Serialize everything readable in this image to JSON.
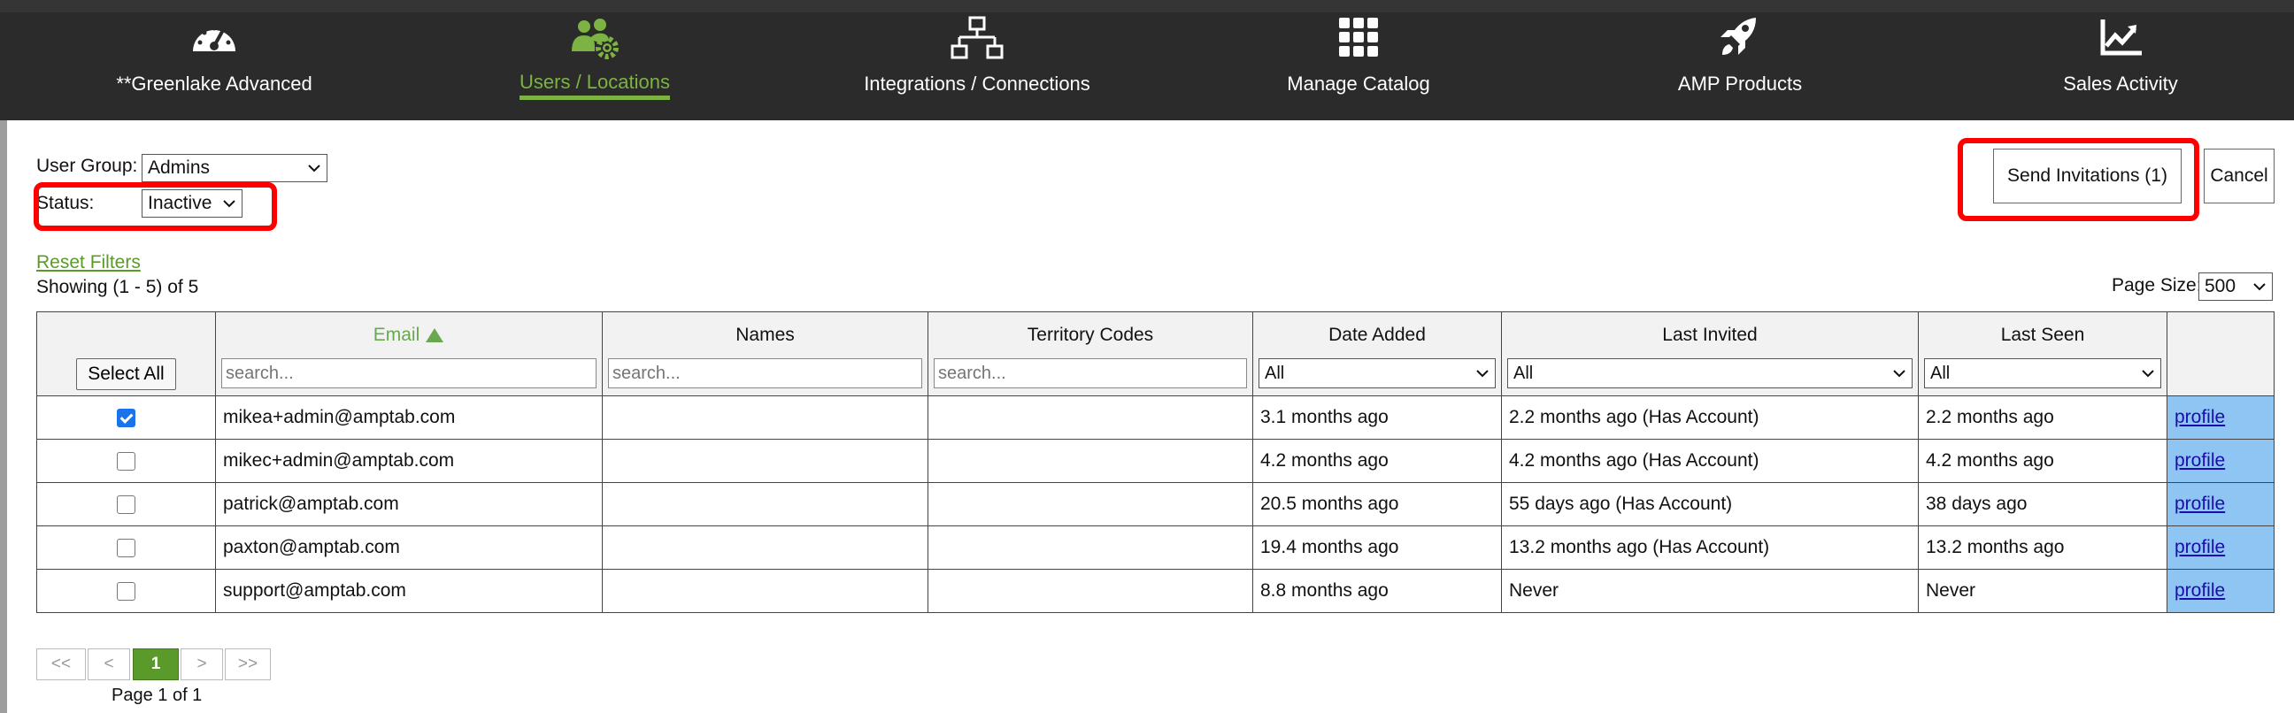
{
  "nav": {
    "items": [
      {
        "label": "**Greenlake Advanced",
        "icon": "dashboard-gauge-icon"
      },
      {
        "label": "Users / Locations",
        "icon": "users-gear-icon",
        "active": true
      },
      {
        "label": "Integrations / Connections",
        "icon": "network-icon"
      },
      {
        "label": "Manage Catalog",
        "icon": "grid-icon"
      },
      {
        "label": "AMP Products",
        "icon": "rocket-icon"
      },
      {
        "label": "Sales Activity",
        "icon": "chart-line-icon"
      }
    ]
  },
  "filters": {
    "user_group_label": "User Group:",
    "user_group_value": "Admins",
    "status_label": "Status:",
    "status_value": "Inactive"
  },
  "actions": {
    "send_invitations": "Send Invitations (1)",
    "cancel": "Cancel"
  },
  "reset_filters": "Reset Filters",
  "showing": "Showing (1 - 5) of 5",
  "page_size_label": "Page Size:",
  "page_size_value": "500",
  "table": {
    "select_all": "Select All",
    "columns": {
      "email": "Email",
      "names": "Names",
      "territory": "Territory Codes",
      "date_added": "Date Added",
      "last_invited": "Last Invited",
      "last_seen": "Last Seen"
    },
    "search_placeholder": "search...",
    "filter_all": "All",
    "rows": [
      {
        "checked": true,
        "email": "mikea+admin@amptab.com",
        "names": "",
        "territory": "",
        "date_added": "3.1 months ago",
        "last_invited": "2.2 months ago (Has Account)",
        "last_seen": "2.2 months ago",
        "link": "profile"
      },
      {
        "checked": false,
        "email": "mikec+admin@amptab.com",
        "names": "",
        "territory": "",
        "date_added": "4.2 months ago",
        "last_invited": "4.2 months ago (Has Account)",
        "last_seen": "4.2 months ago",
        "link": "profile"
      },
      {
        "checked": false,
        "email": "patrick@amptab.com",
        "names": "",
        "territory": "",
        "date_added": "20.5 months ago",
        "last_invited": "55 days ago (Has Account)",
        "last_seen": "38 days ago",
        "link": "profile"
      },
      {
        "checked": false,
        "email": "paxton@amptab.com",
        "names": "",
        "territory": "",
        "date_added": "19.4 months ago",
        "last_invited": "13.2 months ago (Has Account)",
        "last_seen": "13.2 months ago",
        "link": "profile"
      },
      {
        "checked": false,
        "email": "support@amptab.com",
        "names": "",
        "territory": "",
        "date_added": "8.8 months ago",
        "last_invited": "Never",
        "last_seen": "Never",
        "link": "profile"
      }
    ]
  },
  "pager": {
    "first": "<<",
    "prev": "<",
    "current": "1",
    "next": ">",
    "last": ">>",
    "page_of": "Page 1 of 1"
  },
  "colors": {
    "nav_bg": "#2b2b2b",
    "accent_green": "#7cb342",
    "highlight_red": "#ff0000",
    "profile_cell": "#8ec5f2"
  }
}
